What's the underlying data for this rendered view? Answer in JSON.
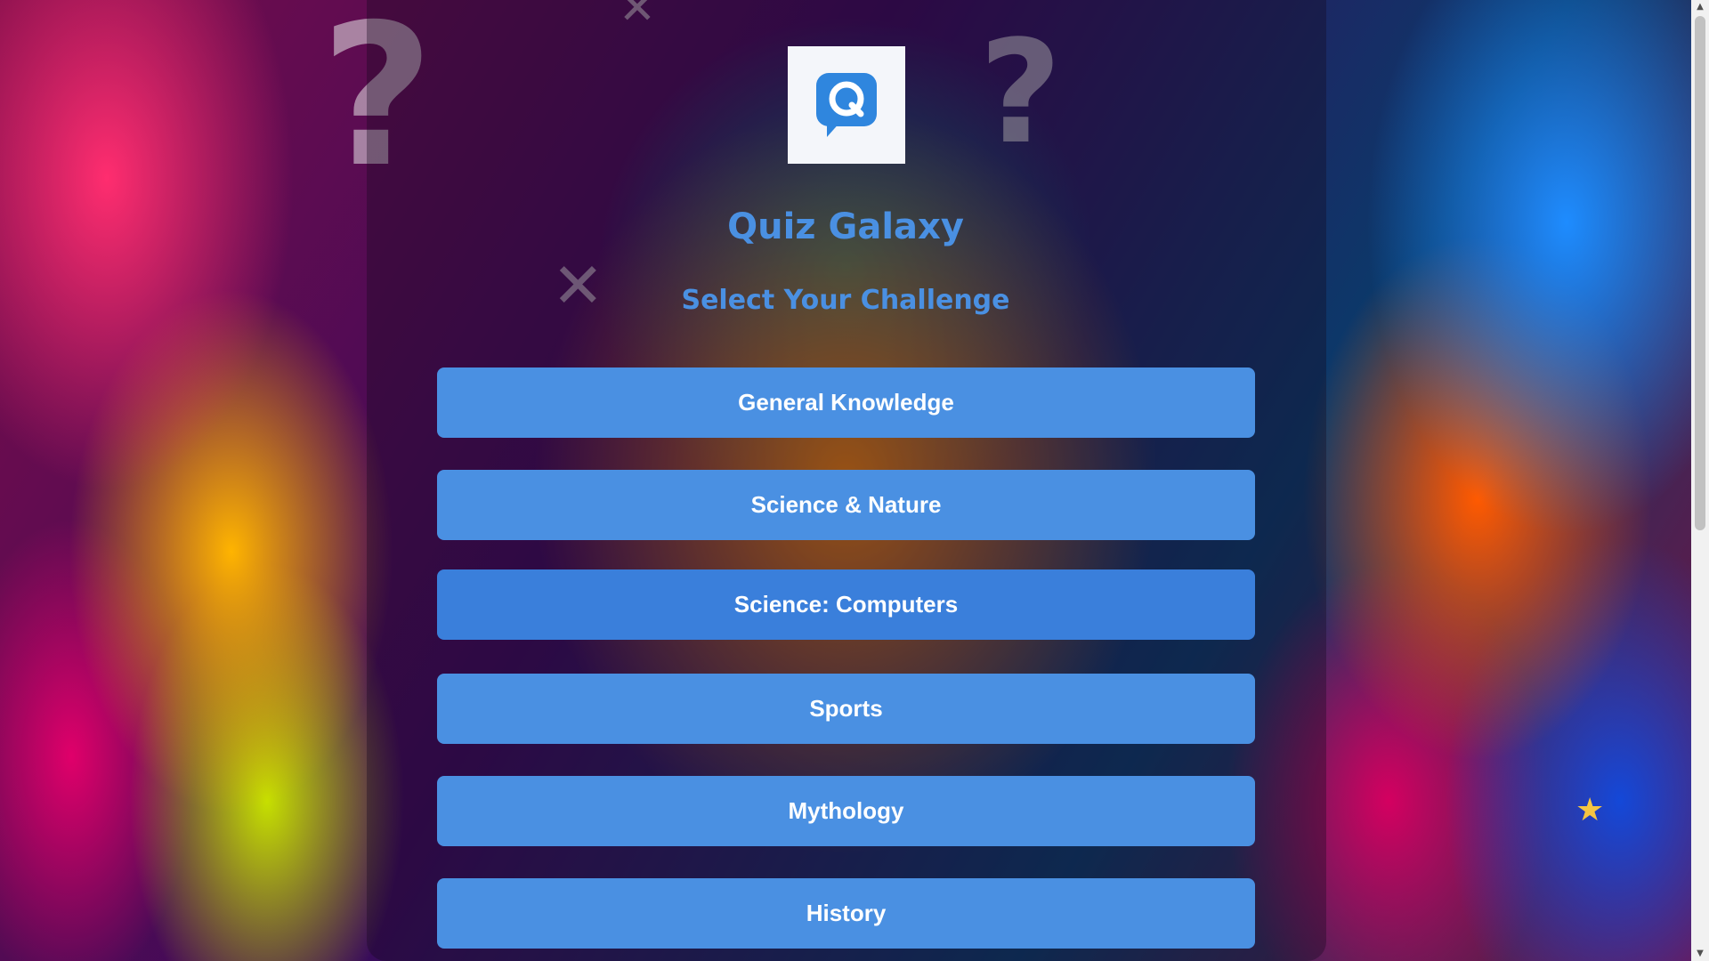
{
  "app": {
    "title": "Quiz Galaxy",
    "subtitle": "Select Your Challenge",
    "logo_letter": "Q"
  },
  "categories": [
    {
      "label": "General Knowledge"
    },
    {
      "label": "Science & Nature"
    },
    {
      "label": "Science: Computers"
    },
    {
      "label": "Sports"
    },
    {
      "label": "Mythology"
    },
    {
      "label": "History"
    }
  ],
  "colors": {
    "accent": "#4a90e2",
    "button_text": "#ffffff",
    "logo_bg": "#f4f6fa"
  },
  "icons": {
    "logo": "chat-bubble-q-icon",
    "scroll_up": "scroll-up-arrow-icon",
    "scroll_down": "scroll-down-arrow-icon"
  }
}
